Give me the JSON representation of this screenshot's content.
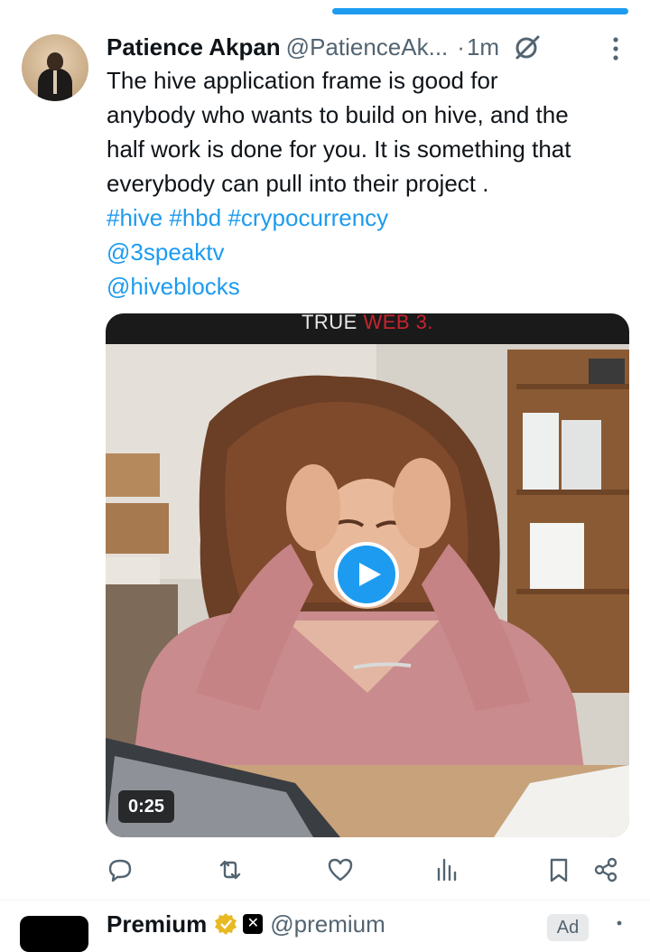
{
  "tweet": {
    "author_name": "Patience Akpan",
    "author_handle": "@PatienceAk...",
    "separator": "·",
    "time": "1m",
    "text_lines": [
      "The hive application frame is good for",
      "anybody who wants to build on hive, and the",
      "half work is done for you. It is something that",
      "everybody can pull into their project ."
    ],
    "hashtags": "#hive #hbd #crypocurrency",
    "mentions": [
      "@3speaktv",
      "@hiveblocks"
    ],
    "media": {
      "banner_text_white": "TRUE ",
      "banner_text_red": "WEB 3.",
      "duration": "0:25"
    }
  },
  "actions": [
    {
      "icon": "reply-icon"
    },
    {
      "icon": "retweet-icon"
    },
    {
      "icon": "like-icon"
    },
    {
      "icon": "views-icon"
    },
    {
      "icon": "bookmark-icon"
    },
    {
      "icon": "share-icon"
    }
  ],
  "next_tweet": {
    "author_name": "Premium",
    "author_handle": "@premium",
    "ad_label": "Ad"
  },
  "colors": {
    "accent": "#1d9bf0",
    "text": "#0f1419",
    "secondary": "#536471"
  }
}
